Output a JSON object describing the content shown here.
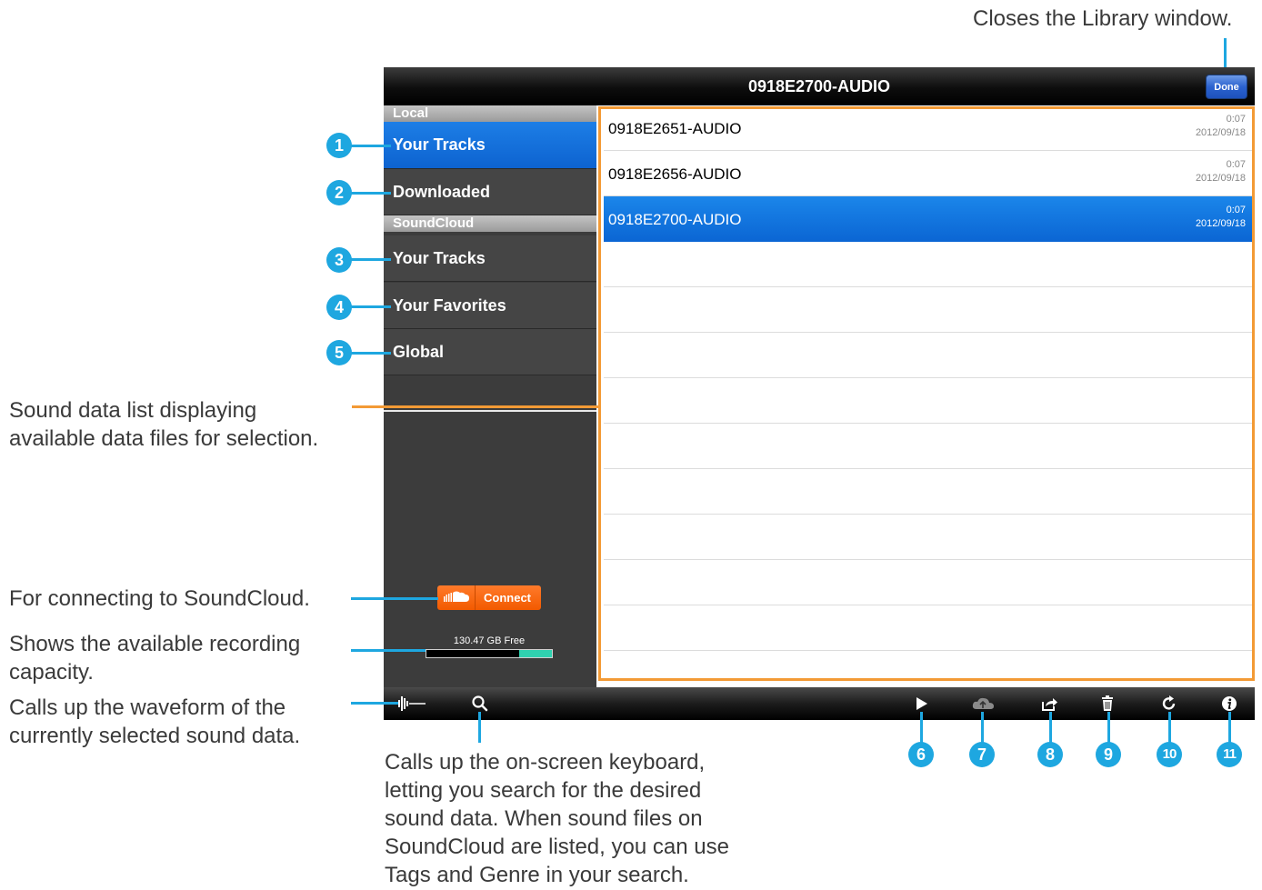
{
  "window": {
    "title": "0918E2700-AUDIO",
    "done_label": "Done"
  },
  "sidebar": {
    "local_header": "Local",
    "soundcloud_header": "SoundCloud",
    "items": [
      {
        "label": "Your Tracks",
        "selected": true
      },
      {
        "label": "Downloaded",
        "selected": false
      },
      {
        "label": "Your Tracks",
        "selected": false
      },
      {
        "label": "Your Favorites",
        "selected": false
      },
      {
        "label": "Global",
        "selected": false
      }
    ],
    "connect_label": "Connect",
    "storage_label": "130.47 GB Free",
    "storage_free_fraction": 0.26
  },
  "tracks": [
    {
      "name": "0918E2651-AUDIO",
      "duration": "0:07",
      "date": "2012/09/18",
      "selected": false
    },
    {
      "name": "0918E2656-AUDIO",
      "duration": "0:07",
      "date": "2012/09/18",
      "selected": false
    },
    {
      "name": "0918E2700-AUDIO",
      "duration": "0:07",
      "date": "2012/09/18",
      "selected": true
    }
  ],
  "toolbar": {
    "icons": [
      "waveform-icon",
      "search-icon",
      "play-icon",
      "cloud-upload-icon",
      "share-icon",
      "trash-icon",
      "refresh-icon",
      "info-icon"
    ]
  },
  "annotations": {
    "done": "Closes the Library window.",
    "list": [
      "Sound data list displaying",
      "available data files for selection."
    ],
    "connect": "For connecting to SoundCloud.",
    "capacity": [
      "Shows the available recording",
      "capacity."
    ],
    "waveform": [
      "Calls up the waveform of the",
      "currently selected sound data."
    ],
    "search": [
      "Calls up the on-screen keyboard,",
      "letting you search for the desired",
      "sound data. When sound files on",
      "SoundCloud are listed, you can use",
      "Tags and Genre in your search."
    ],
    "badges": [
      "1",
      "2",
      "3",
      "4",
      "5",
      "6",
      "7",
      "8",
      "9",
      "10",
      "11"
    ]
  },
  "colors": {
    "accent_blue": "#1ea7e0",
    "selection_blue": "#0d63d0",
    "outline_orange": "#f39a35",
    "soundcloud_orange": "#f25a00",
    "storage_green": "#2fd2b0"
  }
}
